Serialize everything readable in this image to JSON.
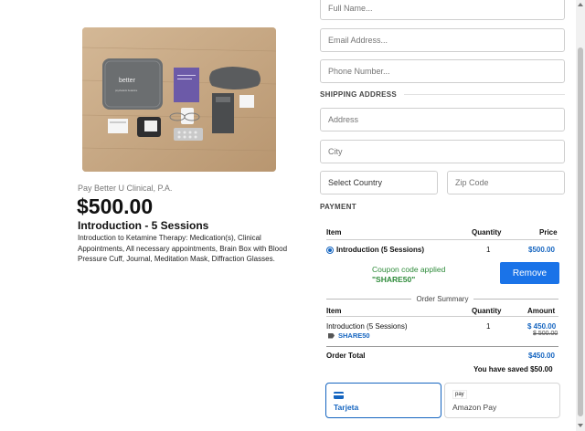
{
  "product": {
    "image_text": "better",
    "image_subtext": "psychedelic Ketamine",
    "merchant": "Pay Better U Clinical, P.A.",
    "price": "$500.00",
    "title": "Introduction - 5 Sessions",
    "description": "Introduction to Ketamine Therapy: Medication(s), Clinical Appointments, All necessary appointments, Brain Box with Blood Pressure Cuff, Journal, Meditation Mask, Diffraction Glasses."
  },
  "form": {
    "full_name_placeholder": "Full Name...",
    "email_placeholder": "Email Address...",
    "phone_placeholder": "Phone Number...",
    "shipping_label": "SHIPPING ADDRESS",
    "address_placeholder": "Address",
    "city_placeholder": "City",
    "country_value": "Select Country",
    "zip_placeholder": "Zip Code"
  },
  "payment": {
    "label": "PAYMENT",
    "headers": {
      "item": "Item",
      "quantity": "Quantity",
      "price": "Price"
    },
    "line": {
      "name": "Introduction (5 Sessions)",
      "quantity": "1",
      "price": "$500.00"
    },
    "coupon_applied": "Coupon code applied",
    "coupon_code": "\"SHARE50\"",
    "remove_label": "Remove"
  },
  "summary": {
    "title": "Order Summary",
    "headers": {
      "item": "Item",
      "quantity": "Quantity",
      "amount": "Amount"
    },
    "line": {
      "name": "Introduction (5 Sessions)",
      "quantity": "1",
      "amount": "$ 450.00",
      "original_amount": "$ 500.00",
      "coupon": "SHARE50"
    },
    "total_label": "Order Total",
    "total_value": "$450.00",
    "saved_text": "You have saved $50.00"
  },
  "methods": [
    {
      "label": "Tarjeta",
      "icon": "credit-card-icon",
      "selected": true
    },
    {
      "label": "Amazon Pay",
      "icon_text": "pay",
      "selected": false
    }
  ],
  "colors": {
    "accent": "#1565c0",
    "button": "#1a73e8",
    "coupon_green": "#2e8b3a"
  }
}
